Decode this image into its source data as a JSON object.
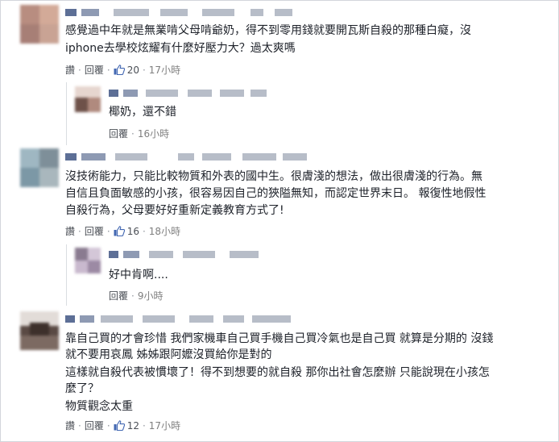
{
  "comments": [
    {
      "text_lines": [
        "感覺過中年就是無業啃父母啃爺奶，得不到零用錢就要開瓦斯自殺的那種白癡，沒",
        "iphone去學校炫耀有什麼好壓力大？過太爽嗎"
      ],
      "actions": {
        "like": "讚",
        "reply": "回覆",
        "likes": "20",
        "time": "17小時"
      },
      "reply": {
        "text": "椰奶，還不錯",
        "actions": {
          "reply": "回覆",
          "time": "16小時"
        }
      }
    },
    {
      "text_lines": [
        "沒技術能力，只能比較物質和外表的國中生。很膚淺的想法，做出很膚淺的行為。無",
        "自信且負面敏感的小孩，很容易因自己的狹隘無知，而認定世界末日。 報復性地假性",
        "自殺行為，父母要好好重新定義教育方式了!"
      ],
      "actions": {
        "like": "讚",
        "reply": "回覆",
        "likes": "16",
        "time": "18小時"
      },
      "reply": {
        "text": "好中肯啊....",
        "actions": {
          "reply": "回覆",
          "time": "9小時"
        }
      }
    },
    {
      "text_lines": [
        "靠自己買的才會珍惜 我們家機車自己買手機自己買冷氣也是自己買 就算是分期的 沒錢",
        "就不要用哀鳳 姊姊跟阿嬤沒買給你是對的",
        "這樣就自殺代表被慣壞了！得不到想要的就自殺 那你出社會怎麼辦 只能說現在小孩怎",
        "麼了？",
        "物質觀念太重"
      ],
      "actions": {
        "like": "讚",
        "reply": "回覆",
        "likes": "12",
        "time": "17小時"
      }
    }
  ],
  "colors": {
    "link": "#4b4f56",
    "like_icon": "#4267b2",
    "meta": "#7f7f7f",
    "text": "#1d2129"
  },
  "icons": {
    "like": "thumbs-up-icon"
  }
}
